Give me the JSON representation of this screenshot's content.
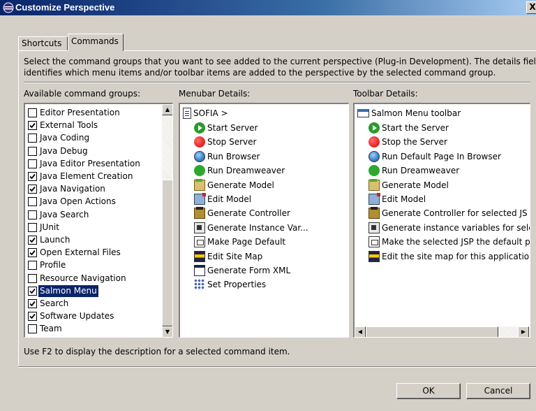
{
  "window": {
    "title": "Customize Perspective",
    "close_label": "X"
  },
  "tabs": [
    {
      "label": "Shortcuts",
      "selected": false
    },
    {
      "label": "Commands",
      "selected": true
    }
  ],
  "description": {
    "line1": "Select the command groups that you want to see added to the current perspective (Plug-in Development).  The details field",
    "line2": "identifies which menu items and/or toolbar items are added to the perspective by the selected command group."
  },
  "columns": {
    "available": "Available command groups:",
    "menubar": "Menubar Details:",
    "toolbar": "Toolbar Details:"
  },
  "command_groups": [
    {
      "label": "Editor Presentation",
      "checked": false,
      "selected": false
    },
    {
      "label": "External Tools",
      "checked": true,
      "selected": false
    },
    {
      "label": "Java Coding",
      "checked": false,
      "selected": false
    },
    {
      "label": "Java Debug",
      "checked": false,
      "selected": false
    },
    {
      "label": "Java Editor Presentation",
      "checked": false,
      "selected": false
    },
    {
      "label": "Java Element Creation",
      "checked": true,
      "selected": false
    },
    {
      "label": "Java Navigation",
      "checked": true,
      "selected": false
    },
    {
      "label": "Java Open Actions",
      "checked": false,
      "selected": false
    },
    {
      "label": "Java Search",
      "checked": false,
      "selected": false
    },
    {
      "label": "JUnit",
      "checked": false,
      "selected": false
    },
    {
      "label": "Launch",
      "checked": true,
      "selected": false
    },
    {
      "label": "Open External Files",
      "checked": true,
      "selected": false
    },
    {
      "label": "Profile",
      "checked": false,
      "selected": false
    },
    {
      "label": "Resource Navigation",
      "checked": false,
      "selected": false
    },
    {
      "label": "Salmon Menu",
      "checked": true,
      "selected": true
    },
    {
      "label": "Search",
      "checked": true,
      "selected": false
    },
    {
      "label": "Software Updates",
      "checked": true,
      "selected": false
    },
    {
      "label": "Team",
      "checked": false,
      "selected": false
    }
  ],
  "menubar_details": {
    "root": {
      "label": "SOFIA  >",
      "icon": "menu-doc-icon"
    },
    "items": [
      {
        "label": "Start Server",
        "icon": "start-icon"
      },
      {
        "label": "Stop Server",
        "icon": "stop-icon"
      },
      {
        "label": "Run Browser",
        "icon": "globe-icon"
      },
      {
        "label": "Run Dreamweaver",
        "icon": "dreamweaver-icon"
      },
      {
        "label": "Generate Model",
        "icon": "model-icon"
      },
      {
        "label": "Edit Model",
        "icon": "edit-model-icon"
      },
      {
        "label": "Generate Controller",
        "icon": "controller-icon"
      },
      {
        "label": "Generate Instance Var...",
        "icon": "instance-var-icon"
      },
      {
        "label": "Make Page Default",
        "icon": "page-default-icon"
      },
      {
        "label": "Edit Site Map",
        "icon": "site-map-icon"
      },
      {
        "label": "Generate Form XML",
        "icon": "form-xml-icon"
      },
      {
        "label": "Set Properties",
        "icon": "properties-icon"
      }
    ]
  },
  "toolbar_details": {
    "root": {
      "label": "Salmon Menu toolbar",
      "icon": "toolbar-icon"
    },
    "items": [
      {
        "label": "Start the Server",
        "icon": "start-icon"
      },
      {
        "label": "Stop the Server",
        "icon": "stop-icon"
      },
      {
        "label": "Run Default Page In Browser",
        "icon": "globe-icon"
      },
      {
        "label": "Run Dreamweaver",
        "icon": "dreamweaver-icon"
      },
      {
        "label": "Generate Model",
        "icon": "model-icon"
      },
      {
        "label": "Edit Model",
        "icon": "edit-model-icon"
      },
      {
        "label": "Generate Controller for selected JS",
        "icon": "controller-icon"
      },
      {
        "label": "Generate instance variables for sele",
        "icon": "instance-var-icon"
      },
      {
        "label": "Make the selected JSP the default p",
        "icon": "page-default-icon"
      },
      {
        "label": "Edit the site map for this application",
        "icon": "site-map-icon"
      }
    ]
  },
  "hint": "Use F2 to display the description for a selected command item.",
  "buttons": {
    "ok": "OK",
    "cancel": "Cancel"
  }
}
